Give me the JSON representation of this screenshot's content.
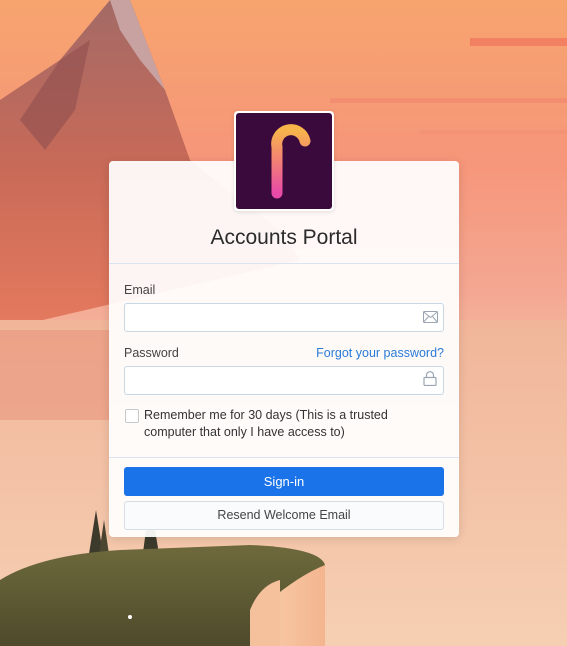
{
  "app": {
    "title": "Accounts Portal",
    "logo_letter": "F",
    "logo_bg": "#3a0a3c"
  },
  "form": {
    "email_label": "Email",
    "email_value": "",
    "email_icon": "envelope-icon",
    "password_label": "Password",
    "password_value": "",
    "password_icon": "lock-icon",
    "forgot_link": "Forgot your password?",
    "remember_checked": false,
    "remember_label": "Remember me for 30 days (This is a trusted computer that only I have access to)"
  },
  "actions": {
    "signin_label": "Sign-in",
    "resend_label": "Resend Welcome Email"
  },
  "colors": {
    "primary": "#1a73e8",
    "link": "#2a7bd8"
  }
}
